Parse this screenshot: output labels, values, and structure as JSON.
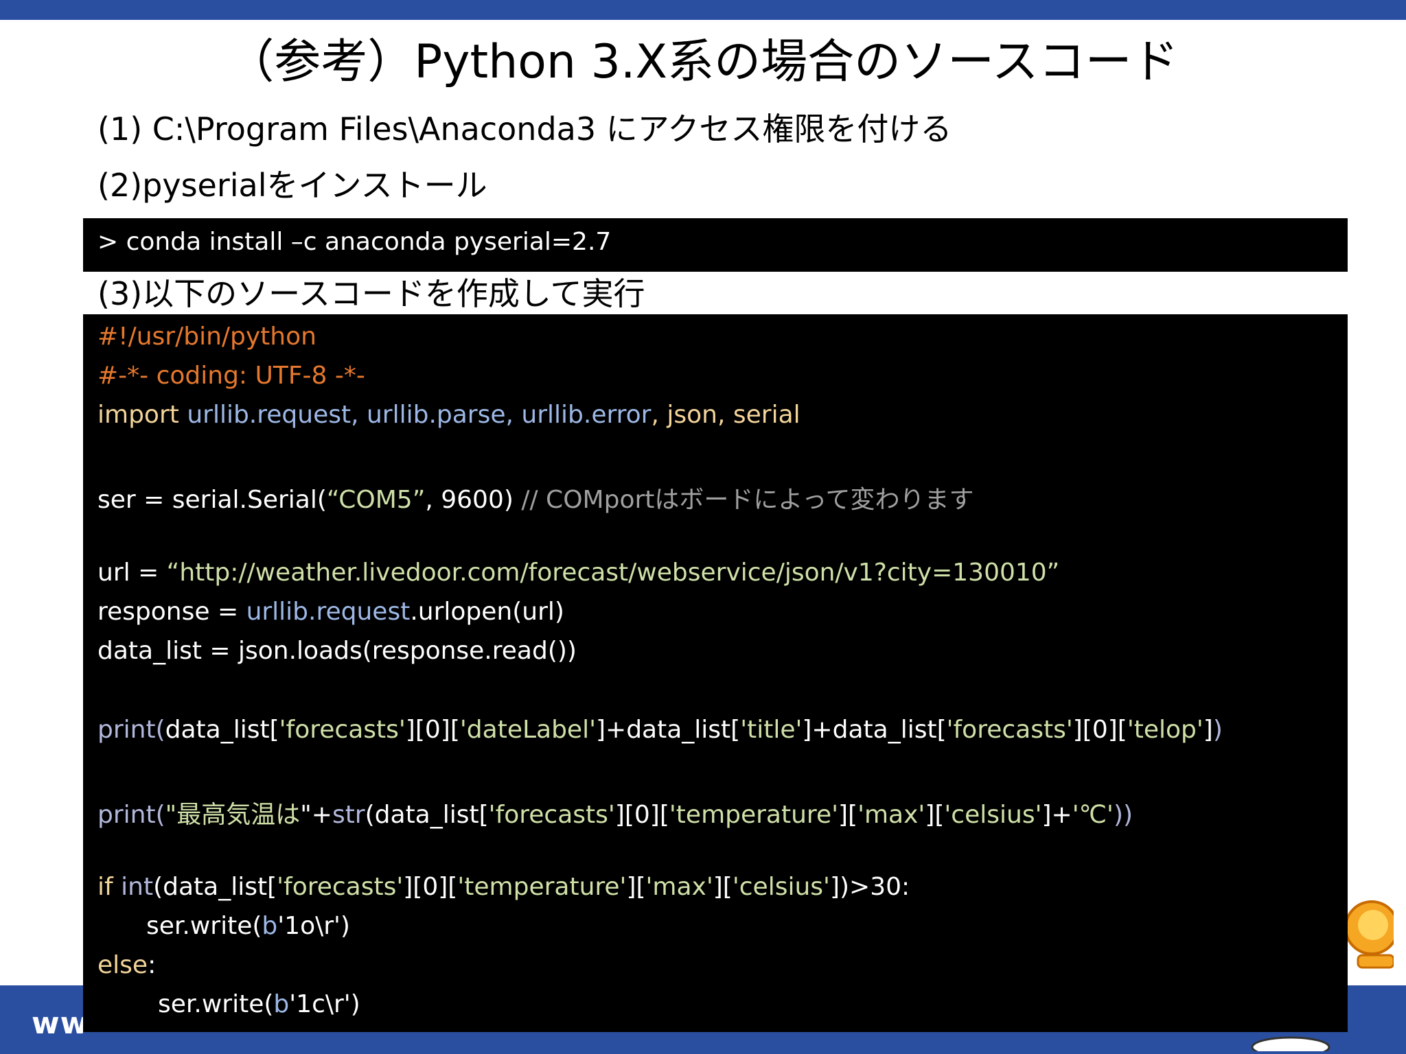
{
  "slide": {
    "title": "（参考）Python 3.X系の場合のソースコード",
    "footer_url": "ww"
  },
  "steps": {
    "step1": "(1) C:\\Program Files\\Anaconda3 にアクセス権限を付ける",
    "step2": "(2)pyserialをインストール",
    "step3": "(3)以下のソースコードを作成して実行"
  },
  "command": "> conda install –c anaconda pyserial=2.7",
  "code": {
    "l1": "#!/usr/bin/python",
    "l2": "#-*- coding: UTF-8 -*-",
    "l3": {
      "import": "import",
      "mods": "urllib.request, urllib.parse, urllib.error",
      "comma": ", ",
      "rest": "json, serial"
    },
    "l4": {
      "a": "ser = serial.Serial(",
      "s": "“COM5”",
      "b": ", 9600)  ",
      "comment": "// COMportはボードによって変わります"
    },
    "l5": {
      "a": "url = ",
      "s": "“http://weather.livedoor.com/forecast/webservice/json/v1?city=130010”"
    },
    "l6": {
      "a": "response = ",
      "mod": "urllib.request",
      "b": ".urlopen(url)"
    },
    "l7": "data_list = json.loads(response.read())",
    "l8": {
      "fn": "print(",
      "p1": "data_list[",
      "s1": "'forecasts'",
      "p2": "][0][",
      "s2": "'dateLabel'",
      "p3": "]+data_list[",
      "s3": "'title'",
      "p4": "]+data_list[",
      "s4": "'forecasts'",
      "p5": "][0][",
      "s5": "'telop'",
      "p6": "]",
      "close": ")"
    },
    "l9": {
      "fn": "print(",
      "s0": "\"最高気温は",
      "p0": "\"+",
      "fn2": "str",
      "p1": "(data_list[",
      "s1": "'forecasts'",
      "p2": "][0][",
      "s2": "'temperature'",
      "p3": "][",
      "s3": "'max'",
      "p4": "][",
      "s4": "'celsius'",
      "p5": "]+",
      "s5": "'℃'",
      "close": "))"
    },
    "l10": {
      "if": "if ",
      "fn": "int",
      "p1": "(data_list[",
      "s1": "'forecasts'",
      "p2": "][0][",
      "s2": "'temperature'",
      "p3": "][",
      "s3": "'max'",
      "p4": "][",
      "s4": "'celsius'",
      "p5": "])>30:"
    },
    "l11": {
      "a": "ser.write(",
      "b": "b",
      "c": "'1o\\r')"
    },
    "l12": {
      "else": "else",
      "colon": ":"
    },
    "l13": {
      "a": "ser.write(",
      "b": "b",
      "c": "'1c\\r')"
    }
  },
  "colors": {
    "bar": "#2b4fa0",
    "code_bg": "#000000",
    "comment": "#e5782e",
    "keyword": "#f3d49a",
    "module": "#9db8e6",
    "string": "#cfe0a8"
  },
  "icons": {
    "mascot": "mascot-illustration"
  }
}
